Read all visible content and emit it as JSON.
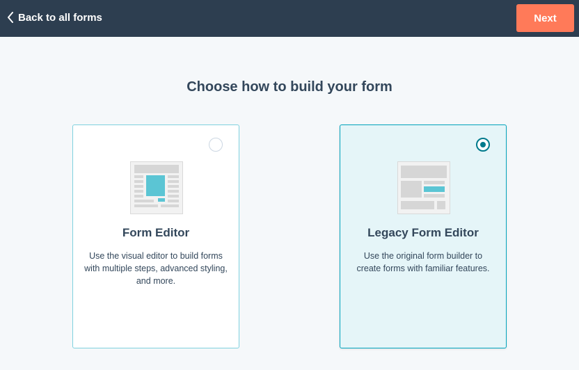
{
  "header": {
    "back_label": "Back to all forms",
    "next_label": "Next"
  },
  "title": "Choose how to build your form",
  "options": [
    {
      "title": "Form Editor",
      "description": "Use the visual editor to build forms with multiple steps, advanced styling, and more.",
      "selected": false,
      "icon": "form-editor-illustration"
    },
    {
      "title": "Legacy Form Editor",
      "description": "Use the original form builder to create forms with familiar features.",
      "selected": true,
      "icon": "legacy-form-editor-illustration"
    }
  ],
  "colors": {
    "header_bg": "#2d3e50",
    "accent": "#ff7a59",
    "selected_border": "#00a4bd",
    "selected_bg": "#e5f5f8",
    "illustration_teal": "#5bc5d4"
  }
}
